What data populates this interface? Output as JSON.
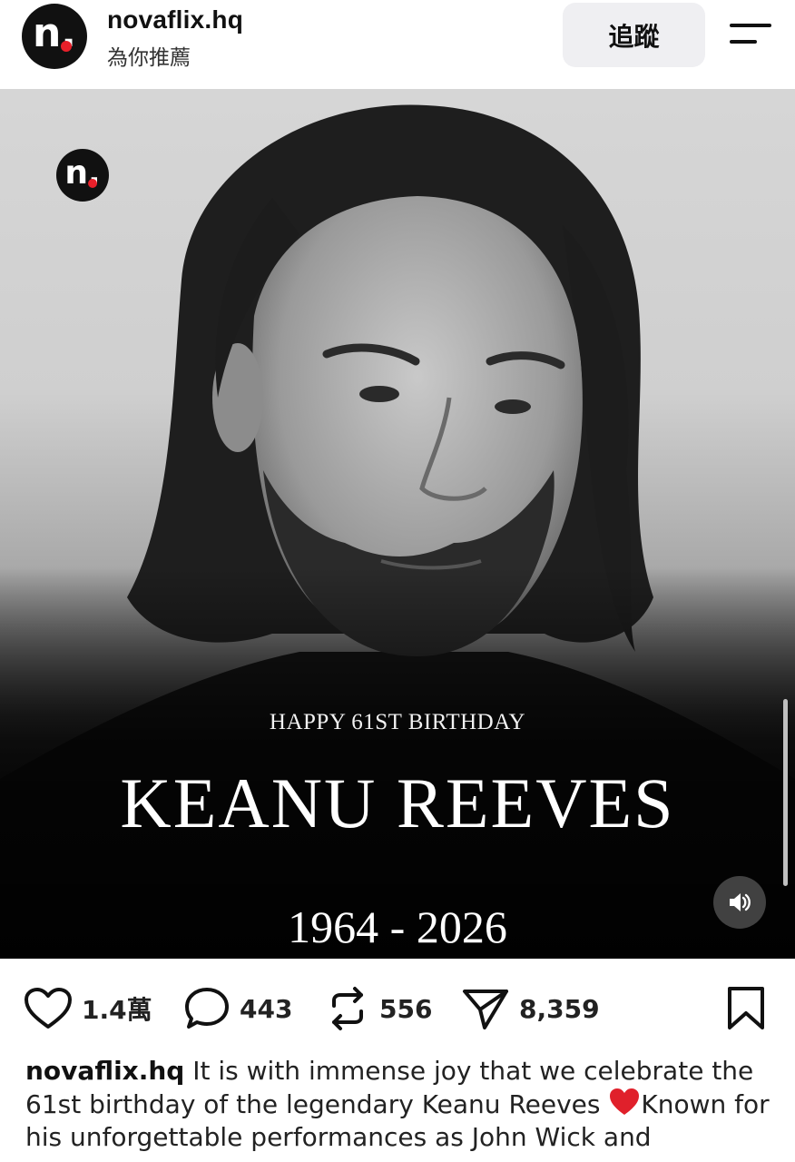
{
  "header": {
    "username": "novaflix.hq",
    "subtitle": "為你推薦",
    "follow_label": "追蹤",
    "avatar_letter": "n."
  },
  "post": {
    "image": {
      "logo_letter": "n.",
      "happy_line": "HAPPY 61ST BIRTHDAY",
      "name_line": "KEANU REEVES",
      "years_line": "1964 - 2026"
    },
    "actions": {
      "likes": "1.4萬",
      "comments": "443",
      "reposts": "556",
      "shares": "8,359"
    },
    "caption": {
      "username": "novaflix.hq",
      "text_1": " It is with immense joy that we celebrate the 61st birthday of the legendary Keanu Reeves ",
      "text_2": "Known for his unforgettable performances as John Wick and"
    }
  },
  "icons": {
    "menu": "menu-icon",
    "heart": "heart-icon",
    "comment": "comment-icon",
    "repost": "repost-icon",
    "share": "send-icon",
    "bookmark": "bookmark-icon",
    "sound": "speaker-icon"
  },
  "colors": {
    "brand_dot": "#e8202a",
    "follow_bg": "#efeff2",
    "text": "#111111"
  }
}
